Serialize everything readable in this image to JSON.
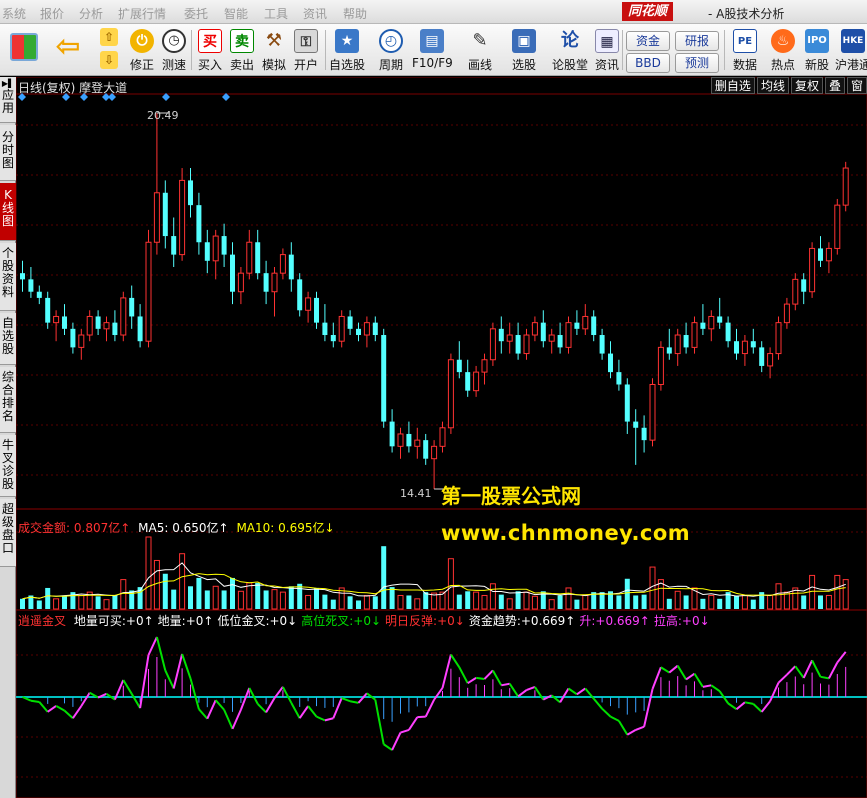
{
  "menu": {
    "items": [
      "系统",
      "报价",
      "分析",
      "扩展行情",
      "委托",
      "智能",
      "工具",
      "资讯",
      "帮助"
    ],
    "brand": "同花顺",
    "app_title": "- A股技术分析"
  },
  "toolbar": {
    "buttons": [
      {
        "label": "修正",
        "icon": "modify-icon"
      },
      {
        "label": "测速",
        "icon": "speedtest-icon"
      },
      {
        "label": "买入",
        "icon": "buy-icon"
      },
      {
        "label": "卖出",
        "icon": "sell-icon"
      },
      {
        "label": "模拟",
        "icon": "simulate-icon"
      },
      {
        "label": "开户",
        "icon": "account-icon"
      },
      {
        "label": "自选股",
        "icon": "watchlist-icon"
      },
      {
        "label": "周期",
        "icon": "period-icon"
      },
      {
        "label": "F10/F9",
        "icon": "f10-icon"
      },
      {
        "label": "画线",
        "icon": "drawline-icon"
      },
      {
        "label": "选股",
        "icon": "stockpick-icon"
      },
      {
        "label": "论股堂",
        "icon": "forum-icon"
      },
      {
        "label": "资讯",
        "icon": "news-icon"
      },
      {
        "label": "数据",
        "icon": "data-icon"
      },
      {
        "label": "热点",
        "icon": "hot-icon"
      },
      {
        "label": "新股",
        "icon": "newstock-icon"
      },
      {
        "label": "沪港通",
        "icon": "hkconnect-icon"
      }
    ],
    "small_buttons": [
      "资金",
      "BBD",
      "研报",
      "预测"
    ],
    "buy_char": "买",
    "sell_char": "卖",
    "lun_char": "论"
  },
  "left_tabs": [
    "应用",
    "分时图",
    "K线图",
    "个股资料",
    "自选股",
    "综合排名",
    "牛叉诊股",
    "超级盘口"
  ],
  "left_tabs_active": 2,
  "chart_header": {
    "title": "日线(复权) 摩登大道",
    "buttons": [
      "删自选",
      "均线",
      "复权",
      "叠",
      "窗"
    ]
  },
  "price": {
    "high_label": "20.49",
    "low_label": "14.41"
  },
  "volume_indicator": {
    "name": "成交金额:",
    "value": "0.807亿↑",
    "ma5_label": "MA5:",
    "ma5_value": "0.650亿↑",
    "ma10_label": "MA10:",
    "ma10_value": "0.695亿↓"
  },
  "custom_indicator": {
    "name": "逍遥金叉",
    "fields": [
      {
        "label": "地量可买:",
        "value": "+0↑",
        "color": "#ffffff"
      },
      {
        "label": "地量:",
        "value": "+0↑",
        "color": "#ffffff"
      },
      {
        "label": "低位金叉:",
        "value": "+0↓",
        "color": "#ffffff"
      },
      {
        "label": "高位死叉:",
        "value": "+0↓",
        "color": "#00e000"
      },
      {
        "label": "明日反弹:",
        "value": "+0↓",
        "color": "#ff3030"
      },
      {
        "label": "资金趋势:",
        "value": "+0.669↑",
        "color": "#ffffff"
      },
      {
        "label": "升:",
        "value": "+0.669↑",
        "color": "#ff40ff"
      },
      {
        "label": "拉高:",
        "value": "+0↓",
        "color": "#ff40ff"
      }
    ]
  },
  "watermark": {
    "line1": "第一股票公式网",
    "line2": "www.chnmoney.com"
  },
  "colors": {
    "up": "#ff3232",
    "down": "#54ffff",
    "ma5": "#ffffff",
    "ma10": "#ffff00",
    "trend_up": "#ff40ff",
    "trend_down": "#00e000",
    "zero_line": "#00c0c0"
  },
  "chart_data": {
    "type": "candlestick",
    "price_high": 20.49,
    "price_low": 14.41,
    "candles": [
      [
        17.9,
        18.1,
        17.6,
        17.8
      ],
      [
        17.8,
        18.0,
        17.5,
        17.6
      ],
      [
        17.6,
        17.7,
        17.4,
        17.5
      ],
      [
        17.5,
        17.6,
        17.0,
        17.1
      ],
      [
        17.1,
        17.3,
        16.8,
        17.2
      ],
      [
        17.2,
        17.4,
        16.9,
        17.0
      ],
      [
        17.0,
        17.1,
        16.6,
        16.7
      ],
      [
        16.7,
        17.0,
        16.5,
        16.9
      ],
      [
        16.9,
        17.3,
        16.8,
        17.2
      ],
      [
        17.2,
        17.3,
        16.9,
        17.0
      ],
      [
        17.0,
        17.2,
        16.8,
        17.1
      ],
      [
        17.1,
        17.3,
        16.8,
        16.9
      ],
      [
        16.9,
        17.6,
        16.8,
        17.5
      ],
      [
        17.5,
        17.7,
        17.0,
        17.2
      ],
      [
        17.2,
        17.4,
        16.7,
        16.8
      ],
      [
        16.8,
        18.6,
        16.7,
        18.4
      ],
      [
        18.4,
        20.49,
        18.2,
        19.2
      ],
      [
        19.2,
        19.4,
        18.3,
        18.5
      ],
      [
        18.5,
        18.8,
        18.0,
        18.2
      ],
      [
        18.2,
        19.6,
        18.1,
        19.4
      ],
      [
        19.4,
        19.6,
        18.8,
        19.0
      ],
      [
        19.0,
        19.2,
        18.2,
        18.4
      ],
      [
        18.4,
        18.6,
        17.9,
        18.1
      ],
      [
        18.1,
        18.6,
        17.8,
        18.5
      ],
      [
        18.5,
        18.7,
        18.0,
        18.2
      ],
      [
        18.2,
        18.4,
        17.4,
        17.6
      ],
      [
        17.6,
        18.0,
        17.4,
        17.9
      ],
      [
        17.9,
        18.6,
        17.8,
        18.4
      ],
      [
        18.4,
        18.6,
        17.8,
        17.9
      ],
      [
        17.9,
        18.1,
        17.4,
        17.6
      ],
      [
        17.6,
        18.0,
        17.2,
        17.9
      ],
      [
        17.9,
        18.3,
        17.8,
        18.2
      ],
      [
        18.2,
        18.4,
        17.6,
        17.8
      ],
      [
        17.8,
        17.9,
        17.2,
        17.3
      ],
      [
        17.3,
        17.6,
        17.1,
        17.5
      ],
      [
        17.5,
        17.6,
        17.0,
        17.1
      ],
      [
        17.1,
        17.4,
        16.8,
        16.9
      ],
      [
        16.9,
        17.1,
        16.7,
        16.8
      ],
      [
        16.8,
        17.3,
        16.7,
        17.2
      ],
      [
        17.2,
        17.3,
        16.9,
        17.0
      ],
      [
        17.0,
        17.1,
        16.8,
        16.9
      ],
      [
        16.9,
        17.2,
        16.7,
        17.1
      ],
      [
        17.1,
        17.2,
        16.8,
        16.9
      ],
      [
        16.9,
        17.0,
        15.4,
        15.5
      ],
      [
        15.5,
        15.7,
        15.0,
        15.1
      ],
      [
        15.1,
        15.4,
        14.9,
        15.3
      ],
      [
        15.3,
        15.5,
        15.0,
        15.1
      ],
      [
        15.1,
        15.4,
        14.9,
        15.2
      ],
      [
        15.2,
        15.3,
        14.8,
        14.9
      ],
      [
        14.9,
        15.2,
        14.41,
        15.1
      ],
      [
        15.1,
        15.5,
        15.0,
        15.4
      ],
      [
        15.4,
        16.6,
        15.3,
        16.5
      ],
      [
        16.5,
        16.8,
        16.2,
        16.3
      ],
      [
        16.3,
        16.5,
        15.9,
        16.0
      ],
      [
        16.0,
        16.4,
        15.9,
        16.3
      ],
      [
        16.3,
        16.6,
        16.1,
        16.5
      ],
      [
        16.5,
        17.1,
        16.4,
        17.0
      ],
      [
        17.0,
        17.2,
        16.6,
        16.8
      ],
      [
        16.8,
        17.1,
        16.6,
        16.9
      ],
      [
        16.9,
        17.1,
        16.5,
        16.6
      ],
      [
        16.6,
        17.0,
        16.5,
        16.9
      ],
      [
        16.9,
        17.2,
        16.8,
        17.1
      ],
      [
        17.1,
        17.3,
        16.7,
        16.8
      ],
      [
        16.8,
        17.0,
        16.6,
        16.9
      ],
      [
        16.9,
        17.1,
        16.6,
        16.7
      ],
      [
        16.7,
        17.2,
        16.6,
        17.1
      ],
      [
        17.1,
        17.3,
        16.9,
        17.0
      ],
      [
        17.0,
        17.4,
        16.9,
        17.2
      ],
      [
        17.2,
        17.3,
        16.8,
        16.9
      ],
      [
        16.9,
        17.0,
        16.5,
        16.6
      ],
      [
        16.6,
        16.8,
        16.2,
        16.3
      ],
      [
        16.3,
        16.5,
        16.0,
        16.1
      ],
      [
        16.1,
        16.2,
        15.3,
        15.5
      ],
      [
        15.5,
        15.7,
        14.8,
        15.4
      ],
      [
        15.4,
        15.6,
        15.0,
        15.2
      ],
      [
        15.2,
        16.2,
        15.1,
        16.1
      ],
      [
        16.1,
        16.8,
        16.0,
        16.7
      ],
      [
        16.7,
        17.0,
        16.5,
        16.6
      ],
      [
        16.6,
        17.0,
        16.4,
        16.9
      ],
      [
        16.9,
        17.1,
        16.6,
        16.7
      ],
      [
        16.7,
        17.2,
        16.6,
        17.1
      ],
      [
        17.1,
        17.4,
        16.9,
        17.0
      ],
      [
        17.0,
        17.3,
        16.8,
        17.2
      ],
      [
        17.2,
        17.5,
        17.0,
        17.1
      ],
      [
        17.1,
        17.2,
        16.7,
        16.8
      ],
      [
        16.8,
        17.0,
        16.5,
        16.6
      ],
      [
        16.6,
        16.9,
        16.4,
        16.8
      ],
      [
        16.8,
        17.0,
        16.6,
        16.7
      ],
      [
        16.7,
        16.8,
        16.3,
        16.4
      ],
      [
        16.4,
        16.7,
        16.2,
        16.6
      ],
      [
        16.6,
        17.2,
        16.5,
        17.1
      ],
      [
        17.1,
        17.5,
        17.0,
        17.4
      ],
      [
        17.4,
        17.9,
        17.3,
        17.8
      ],
      [
        17.8,
        17.9,
        17.4,
        17.6
      ],
      [
        17.6,
        18.4,
        17.5,
        18.3
      ],
      [
        18.3,
        18.5,
        18.0,
        18.1
      ],
      [
        18.1,
        18.4,
        17.9,
        18.3
      ],
      [
        18.3,
        19.1,
        18.2,
        19.0
      ],
      [
        19.0,
        19.7,
        18.9,
        19.6
      ]
    ]
  }
}
